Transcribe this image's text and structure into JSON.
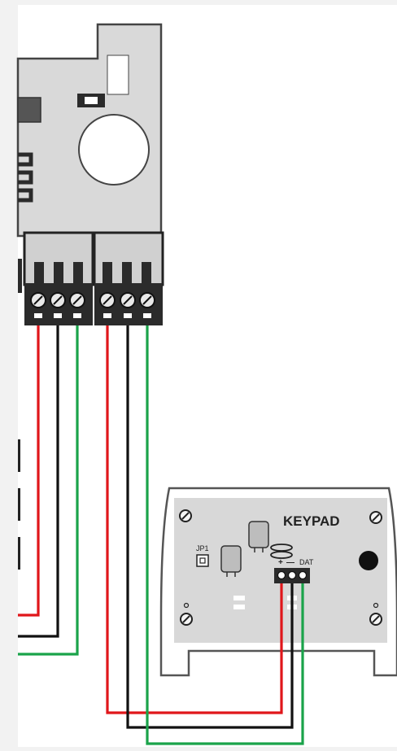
{
  "colors": {
    "background": "#f2f2f2",
    "panel": "#ffffff",
    "board": "#d8d8d8",
    "board_outline": "#3a3a3a",
    "terminal_dark": "#2b2b2b",
    "terminal_mid": "#bdbdbd",
    "wire_red": "#e0161a",
    "wire_black": "#111111",
    "wire_green": "#1aa34a"
  },
  "keypad": {
    "label": "KEYPAD",
    "jumper_label": "JP1",
    "terminal_plus": "+",
    "terminal_minus": "—",
    "terminal_data": "DAT"
  },
  "wires": [
    {
      "name": "red",
      "color_key": "wire_red"
    },
    {
      "name": "black",
      "color_key": "wire_black"
    },
    {
      "name": "green",
      "color_key": "wire_green"
    }
  ]
}
